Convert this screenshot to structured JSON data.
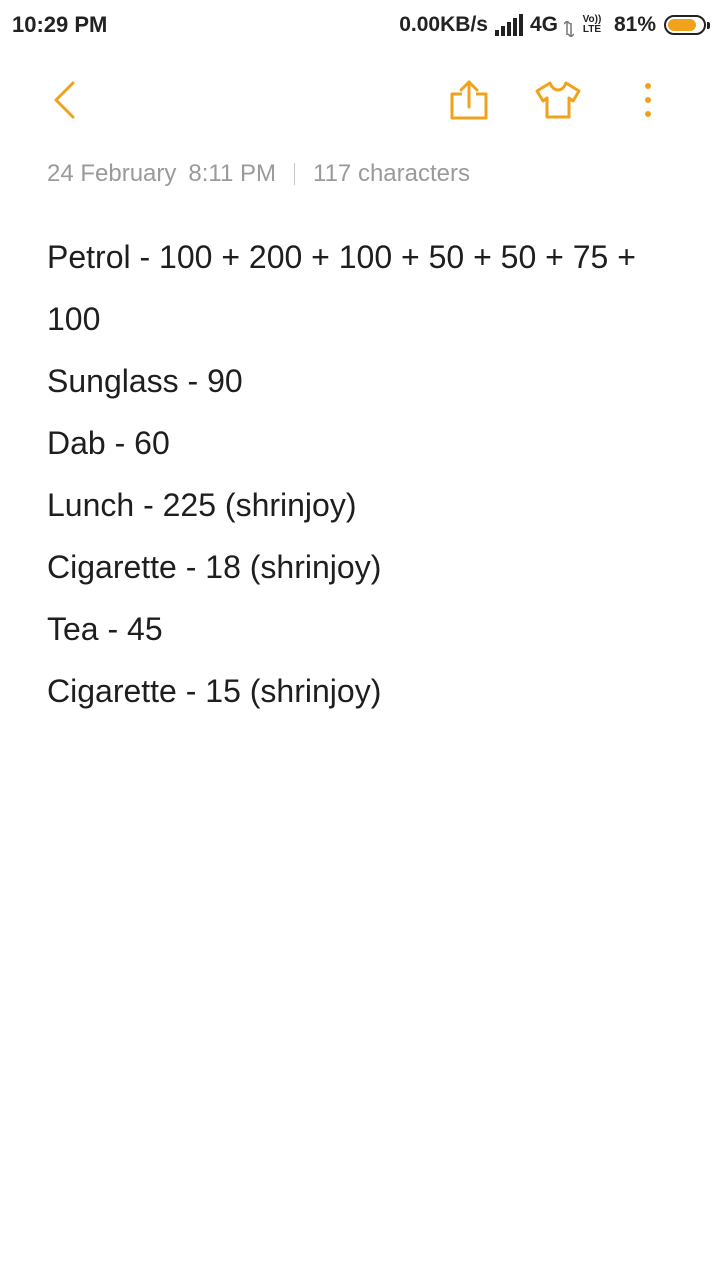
{
  "status_bar": {
    "time": "10:29 PM",
    "net_speed": "0.00KB/s",
    "network_type": "4G",
    "volte_top": "Vo))",
    "volte_bottom": "LTE",
    "battery_percent": "81%",
    "battery_level": 0.81,
    "icons": [
      "signal-icon",
      "data-arrows-icon",
      "volte-icon",
      "battery-icon"
    ]
  },
  "toolbar": {
    "accent_color": "#f0a21c",
    "icons": [
      "back-arrow-icon",
      "share-icon",
      "theme-shirt-icon",
      "more-options-icon"
    ]
  },
  "meta": {
    "date": "24 February",
    "time": "8:11 PM",
    "character_count": "117 characters"
  },
  "note": {
    "lines": [
      "Petrol - 100 + 200 + 100 + 50 + 50 + 75 + 100",
      "Sunglass - 90",
      "Dab - 60",
      "Lunch - 225 (shrinjoy)",
      "Cigarette - 18 (shrinjoy)",
      "Tea - 45",
      "Cigarette - 15 (shrinjoy)"
    ]
  }
}
